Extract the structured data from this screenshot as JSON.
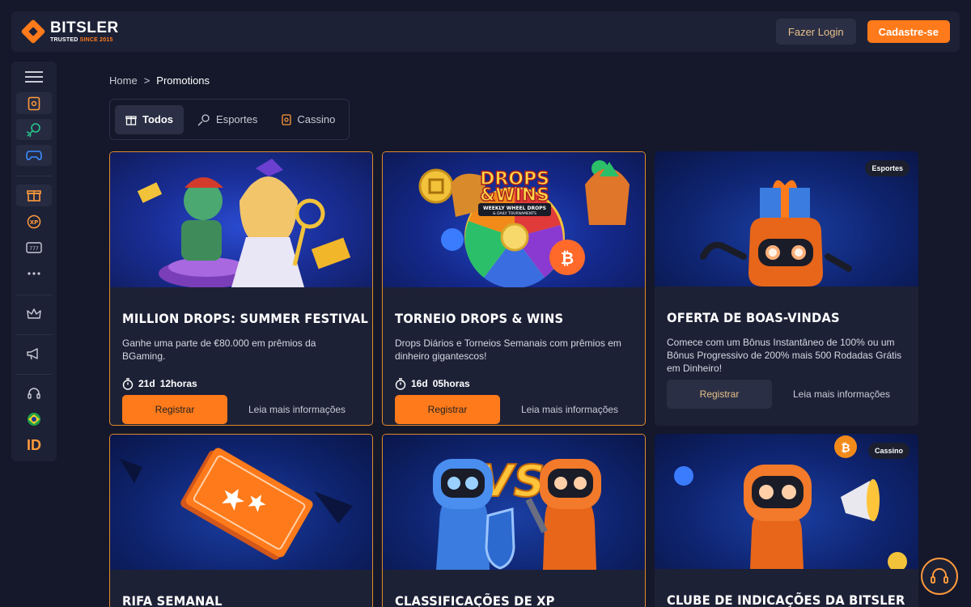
{
  "header": {
    "logo_name": "BITSLER",
    "logo_tag_prefix": "TRUSTED",
    "logo_tag_accent": "SINCE 2015",
    "login_label": "Fazer Login",
    "signup_label": "Cadastre-se"
  },
  "sidebar": {
    "items": [
      "menu-icon",
      "casino-icon",
      "sports-icon",
      "esports-icon",
      "gift-icon",
      "xp-icon",
      "slots-icon",
      "more-icon",
      "vip-crown-icon",
      "promotions-megaphone-icon",
      "support-headset-icon",
      "brazil-flag-icon"
    ],
    "language": "ID"
  },
  "breadcrumb": {
    "home": "Home",
    "separator": ">",
    "current": "Promotions"
  },
  "tabs": [
    {
      "label": "Todos",
      "active": true
    },
    {
      "label": "Esportes",
      "active": false
    },
    {
      "label": "Cassino",
      "active": false
    }
  ],
  "cards": [
    {
      "title": "MILLION DROPS: SUMMER FESTIVAL",
      "description": "Ganhe uma parte de €80.000 em prêmios da BGaming.",
      "timer_days": "21d",
      "timer_hours": "12horas",
      "register_label": "Registrar",
      "more_label": "Leia mais informações"
    },
    {
      "title": "TORNEIO DROPS & WINS",
      "description": "Drops Diários e Torneios Semanais com prêmios em dinheiro gigantescos!",
      "timer_days": "16d",
      "timer_hours": "05horas",
      "register_label": "Registrar",
      "more_label": "Leia mais informações",
      "image_text": {
        "line1": "DROPS",
        "line2": "&WINS",
        "sub1": "WEEKLY WHEEL DROPS",
        "sub2": "& DAILY TOURNAMENTS"
      }
    },
    {
      "title": "OFERTA DE BOAS-VINDAS",
      "description": "Comece com um Bônus Instantâneo de 100% ou um Bônus Progressivo de 200% mais 500 Rodadas Grátis em Dinheiro!",
      "badge": "Esportes",
      "register_label": "Registrar",
      "more_label": "Leia mais informações"
    },
    {
      "title": "RIFA SEMANAL"
    },
    {
      "title": "CLASSIFICAÇÕES DE XP"
    },
    {
      "title": "CLUBE DE INDICAÇÕES DA BITSLER",
      "badge": "Cassino"
    }
  ],
  "colors": {
    "accent": "#ff7a1a",
    "background": "#15182a",
    "panel": "#1d2136"
  }
}
